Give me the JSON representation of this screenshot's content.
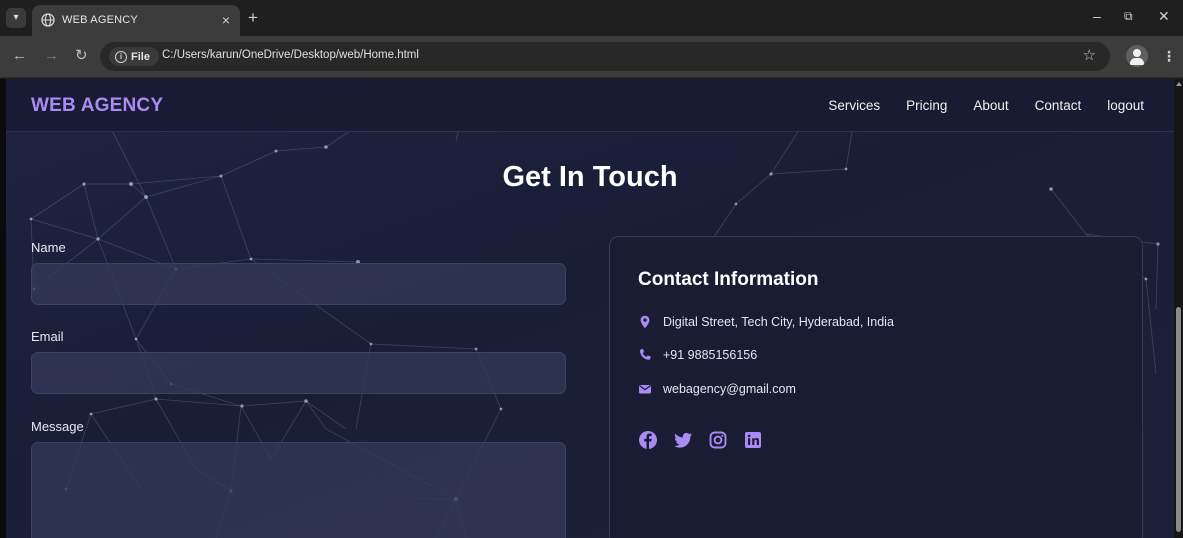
{
  "browser": {
    "tab": {
      "title": "WEB AGENCY",
      "close": "×",
      "favicon": "globe-icon"
    },
    "new_tab": "+",
    "window": {
      "minimize": "–",
      "restore": "⧉",
      "close": "✕"
    },
    "site_label": "File",
    "url": "C:/Users/karun/OneDrive/Desktop/web/Home.html",
    "bookmark_star": "☆"
  },
  "page": {
    "brand": "WEB AGENCY",
    "nav": [
      "Services",
      "Pricing",
      "About",
      "Contact",
      "logout"
    ],
    "heading": "Get In Touch",
    "form": {
      "name_label": "Name",
      "email_label": "Email",
      "message_label": "Message"
    },
    "contact": {
      "title": "Contact Information",
      "address": "Digital Street, Tech City, Hyderabad, India",
      "phone": "+91 9885156156",
      "email": "webagency@gmail.com",
      "socials": [
        "facebook-icon",
        "twitter-icon",
        "instagram-icon",
        "linkedin-icon"
      ]
    }
  },
  "colors": {
    "accent": "#a98bf3",
    "background": "#1c2038",
    "card": "#191c32"
  }
}
